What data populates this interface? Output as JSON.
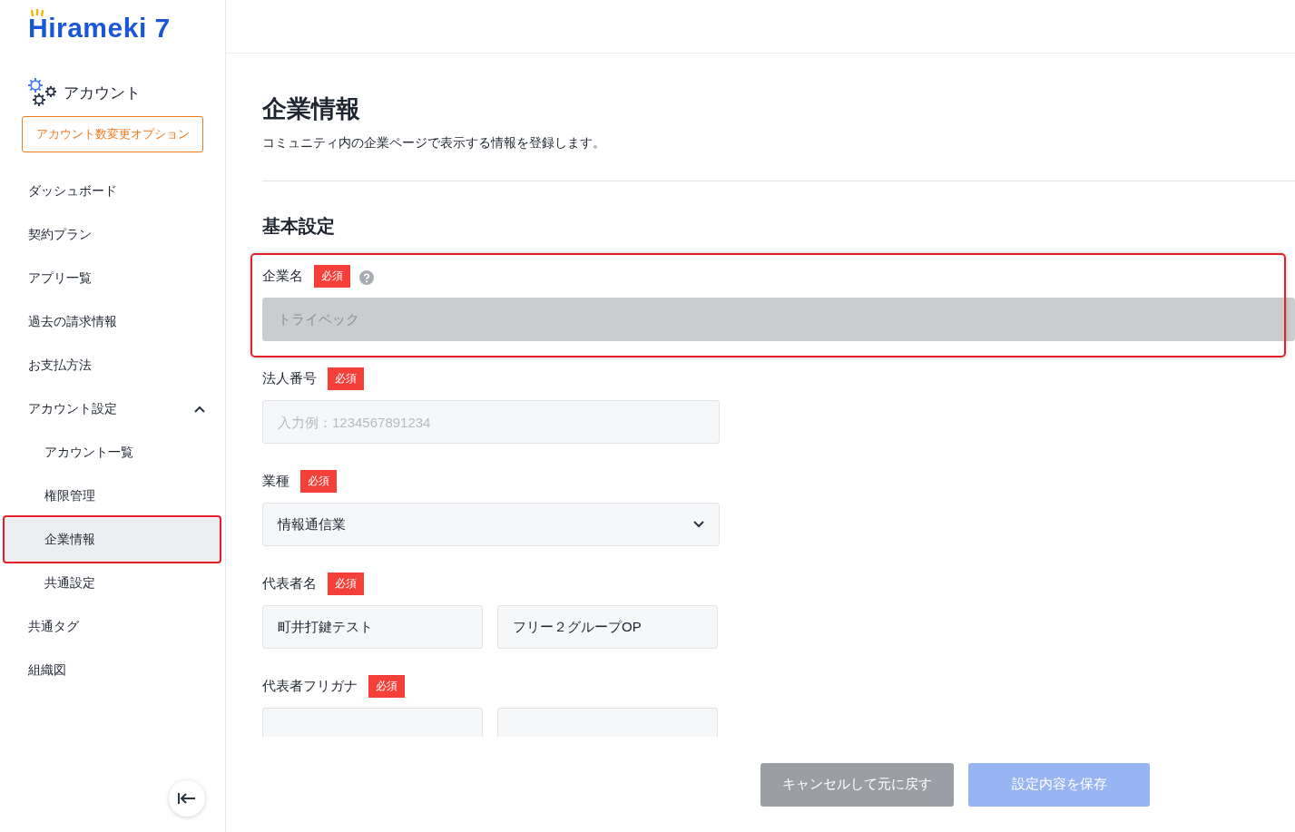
{
  "sidebar": {
    "logo": "Hirameki 7",
    "account_title": "アカウント",
    "option_button": "アカウント数変更オプション",
    "items": [
      {
        "label": "ダッシュボード",
        "selected": false,
        "highlighted": false
      },
      {
        "label": "契約プラン",
        "selected": false,
        "highlighted": false
      },
      {
        "label": "アプリ一覧",
        "selected": false,
        "highlighted": false
      },
      {
        "label": "過去の請求情報",
        "selected": false,
        "highlighted": false
      },
      {
        "label": "お支払方法",
        "selected": false,
        "highlighted": false
      },
      {
        "label": "アカウント設定",
        "selected": false,
        "highlighted": false,
        "expanded": true,
        "children": [
          {
            "label": "アカウント一覧",
            "selected": false,
            "highlighted": false
          },
          {
            "label": "権限管理",
            "selected": false,
            "highlighted": false
          },
          {
            "label": "企業情報",
            "selected": true,
            "highlighted": true
          },
          {
            "label": "共通設定",
            "selected": false,
            "highlighted": false
          }
        ]
      },
      {
        "label": "共通タグ",
        "selected": false,
        "highlighted": false
      },
      {
        "label": "組織図",
        "selected": false,
        "highlighted": false
      }
    ]
  },
  "page": {
    "title": "企業情報",
    "description": "コミュニティ内の企業ページで表示する情報を登録します。",
    "section": "基本設定",
    "fields": [
      {
        "kind": "text",
        "label": "企業名",
        "badge": "必須",
        "help": true,
        "disabled": true,
        "highlighted": true,
        "value": "トライベック"
      },
      {
        "kind": "text",
        "label": "法人番号",
        "badge": "必須",
        "help": false,
        "disabled": false,
        "highlighted": false,
        "placeholder": "入力例：1234567891234"
      },
      {
        "kind": "select",
        "label": "業種",
        "badge": "必須",
        "help": false,
        "disabled": false,
        "highlighted": false,
        "value": "情報通信業"
      },
      {
        "kind": "pair",
        "label": "代表者名",
        "badge": "必須",
        "help": false,
        "disabled": false,
        "highlighted": false,
        "values": [
          "町井打鍵テスト",
          "フリー２グループOP"
        ]
      },
      {
        "kind": "pair",
        "label": "代表者フリガナ",
        "badge": "必須",
        "help": false,
        "disabled": false,
        "highlighted": false
      }
    ]
  },
  "buttons": [
    {
      "kind": "cancel",
      "label": "キャンセルして元に戻す",
      "disabled": true
    },
    {
      "kind": "save",
      "label": "設定内容を保存",
      "disabled": true
    }
  ]
}
